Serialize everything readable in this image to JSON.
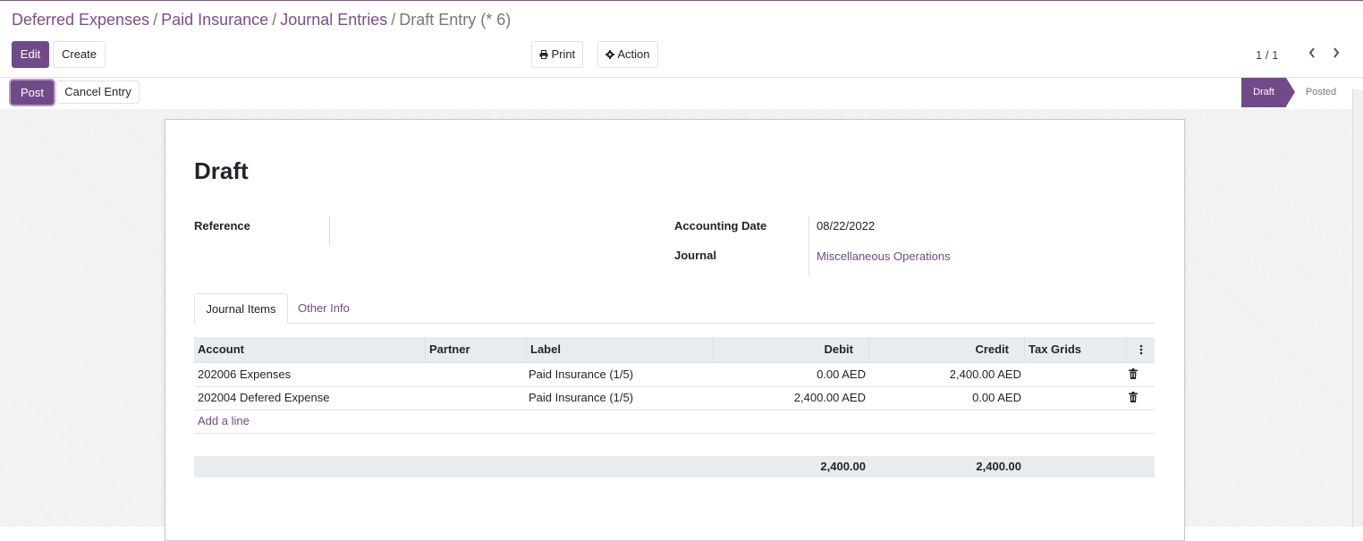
{
  "breadcrumb": {
    "items": [
      "Deferred Expenses",
      "Paid Insurance",
      "Journal Entries"
    ],
    "separator": "/",
    "current": "Draft Entry (* 6)"
  },
  "toolbar": {
    "edit_label": "Edit",
    "create_label": "Create",
    "print_label": "Print",
    "action_label": "Action",
    "pager": "1 / 1"
  },
  "statusbar": {
    "post_label": "Post",
    "cancel_label": "Cancel Entry",
    "stages": [
      "Draft",
      "Posted"
    ],
    "active_stage": "Draft"
  },
  "form": {
    "title": "Draft",
    "reference_label": "Reference",
    "reference_value": "",
    "accounting_date_label": "Accounting Date",
    "accounting_date_value": "08/22/2022",
    "journal_label": "Journal",
    "journal_value": "Miscellaneous Operations"
  },
  "tabs": [
    "Journal Items",
    "Other Info"
  ],
  "table": {
    "columns": [
      "Account",
      "Partner",
      "Label",
      "Debit",
      "Credit",
      "Tax Grids"
    ],
    "rows": [
      {
        "account": "202006 Expenses",
        "partner": "",
        "label": "Paid Insurance (1/5)",
        "debit": "0.00 AED",
        "credit": "2,400.00 AED",
        "tax_grids": ""
      },
      {
        "account": "202004 Defered Expense",
        "partner": "",
        "label": "Paid Insurance (1/5)",
        "debit": "2,400.00 AED",
        "credit": "0.00 AED",
        "tax_grids": ""
      }
    ],
    "add_line_label": "Add a line",
    "total_debit": "2,400.00",
    "total_credit": "2,400.00"
  },
  "colors": {
    "accent": "#714b89",
    "link": "#714b89"
  }
}
